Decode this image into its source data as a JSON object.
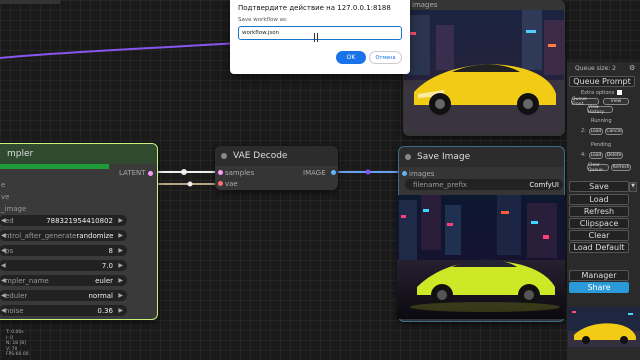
{
  "dialog": {
    "title": "Подтвердите действие на 127.0.0.1:8188",
    "prompt_label": "Save workflow as:",
    "input_value": "workflow.json",
    "ok_label": "OK",
    "cancel_label": "Отмена"
  },
  "ksampler": {
    "title": "mpler",
    "output_label": "LATENT",
    "inputs": [
      "e",
      "ve",
      "_image"
    ],
    "widgets": [
      {
        "name": "ed",
        "value": "788321954410802"
      },
      {
        "name": "ntrol_after_generate",
        "value": "randomize"
      },
      {
        "name": "ps",
        "value": "8"
      },
      {
        "name": "",
        "value": "7.0"
      },
      {
        "name": "mpler_name",
        "value": "euler"
      },
      {
        "name": "eduler",
        "value": "normal"
      },
      {
        "name": "noise",
        "value": "0.36"
      }
    ]
  },
  "vae_decode": {
    "title": "VAE Decode",
    "input_samples": "samples",
    "input_vae": "vae",
    "output_image": "IMAGE"
  },
  "save_image": {
    "title": "Save Image",
    "input_images": "images",
    "widget_name": "filename_prefix",
    "widget_value": "ComfyUI"
  },
  "preview_node": {
    "title": "images"
  },
  "panel": {
    "queue_size": "Queue size: 2",
    "gear": "⚙",
    "queue_prompt": "Queue Prompt",
    "extra_options": "Extra options",
    "tiny_buttons": [
      "Queue Front",
      "View",
      "View History"
    ],
    "running_label": "Running",
    "running_idx": "2:",
    "load_label": "Load",
    "cancel_label": "Cancel",
    "pending_label": "Pending",
    "pending_idx": "4:",
    "delete_label": "Delete",
    "clear_queue": "Clear Queue",
    "refresh_small": "Refresh",
    "save": "Save",
    "load": "Load",
    "refresh": "Refresh",
    "clipspace": "Clipspace",
    "clear": "Clear",
    "load_default": "Load Default",
    "manager": "Manager",
    "share": "Share"
  },
  "stats": [
    "T: 0.00s",
    "I: 0",
    "N: 18 [8]",
    "V: 70",
    "FPS:60.00"
  ],
  "colors": {
    "ksampler_border": "#c8f07a",
    "progress": "#1f9c3a",
    "wire_purple": "#8855ee",
    "wire_white": "#eeeeee",
    "wire_blue": "#6aa0f0",
    "node_border_blue": "#3a6f88",
    "share_button": "#2a9bd8",
    "dialog_ok": "#1a73e8"
  }
}
